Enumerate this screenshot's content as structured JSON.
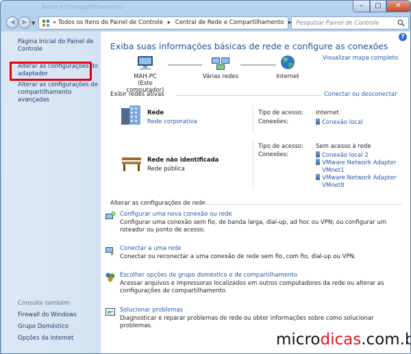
{
  "window": {
    "title": "Rede e Compartilhamento",
    "caption_buttons": {
      "minimize": "–",
      "maximize": "□",
      "close": "✕"
    }
  },
  "navigation": {
    "breadcrumbs": [
      "«",
      "Todos os Itens do Painel de Controle",
      "Central de Rede e Compartilhamento"
    ],
    "search_placeholder": "Pesquisar Painel de Controle"
  },
  "sidebar": {
    "links": [
      {
        "label_line1": "Página Inicial do Painel de",
        "label_line2": "Controle"
      },
      {
        "label_line1": "Alterar as configurações do",
        "label_line2": "adaptador"
      },
      {
        "label_line1": "Alterar as configurações de",
        "label_line2": "compartilhamento avançadas"
      }
    ],
    "see_also_heading": "Consulte também",
    "see_also": [
      "Firewall do Windows",
      "Grupo Doméstico",
      "Opções da Internet"
    ]
  },
  "main": {
    "title": "Exiba suas informações básicas de rede e configure as conexões",
    "full_map_link": "Visualizar mapa completo",
    "map": {
      "computer_name": "MAH-PC",
      "computer_sub": "(Este computador)",
      "networks": "Várias redes",
      "internet": "Internet"
    },
    "active_networks_label": "Exibir redes ativas",
    "connect_link": "Conectar ou desconectar",
    "networks": [
      {
        "name": "Rede",
        "type": "Rede corporativa",
        "access_label": "Tipo de acesso:",
        "access_value": "Internet",
        "connections_label": "Conexões:",
        "connections": [
          "Conexão local"
        ]
      },
      {
        "name": "Rede não identificada",
        "type": "Rede pública",
        "access_label": "Tipo de acesso:",
        "access_value": "Sem acesso à rede",
        "connections_label": "Conexões:",
        "connections": [
          "Conexão local 2",
          "VMware Network Adapter",
          "VMnet1",
          "VMware Network Adapter",
          "VMnet8"
        ]
      }
    ],
    "settings_label": "Alterar as configurações de rede",
    "tasks": [
      {
        "title": "Configurar uma nova conexão ou rede",
        "desc1": "Configurar uma conexão sem fio, de banda larga, dial-up, ad hoc ou VPN; ou configurar um",
        "desc2": "roteador ou ponto de acesso."
      },
      {
        "title": "Conectar a uma rede",
        "desc1": "Conectar ou reconectar a uma conexão de rede sem fio, com fio, dial-up ou VPN.",
        "desc2": ""
      },
      {
        "title": "Escolher opções de grupo doméstico e de compartilhamento",
        "desc1": "Acessar arquivos e impressoras localizados em outros computadores da rede ou alterar as",
        "desc2": "configurações de compartilhamento."
      },
      {
        "title": "Solucionar problemas",
        "desc1": "Diagnosticar e reparar problemas de rede ou obter informações sobre como solucionar problemas.",
        "desc2": ""
      }
    ]
  },
  "watermark": {
    "part1": "micro",
    "part2": "dicas",
    "part3": ".com.br"
  },
  "colors": {
    "link": "#1e5aa8",
    "title": "#1d4f99",
    "highlight": "#e1000e",
    "watermark_accent": "#e0141c"
  }
}
